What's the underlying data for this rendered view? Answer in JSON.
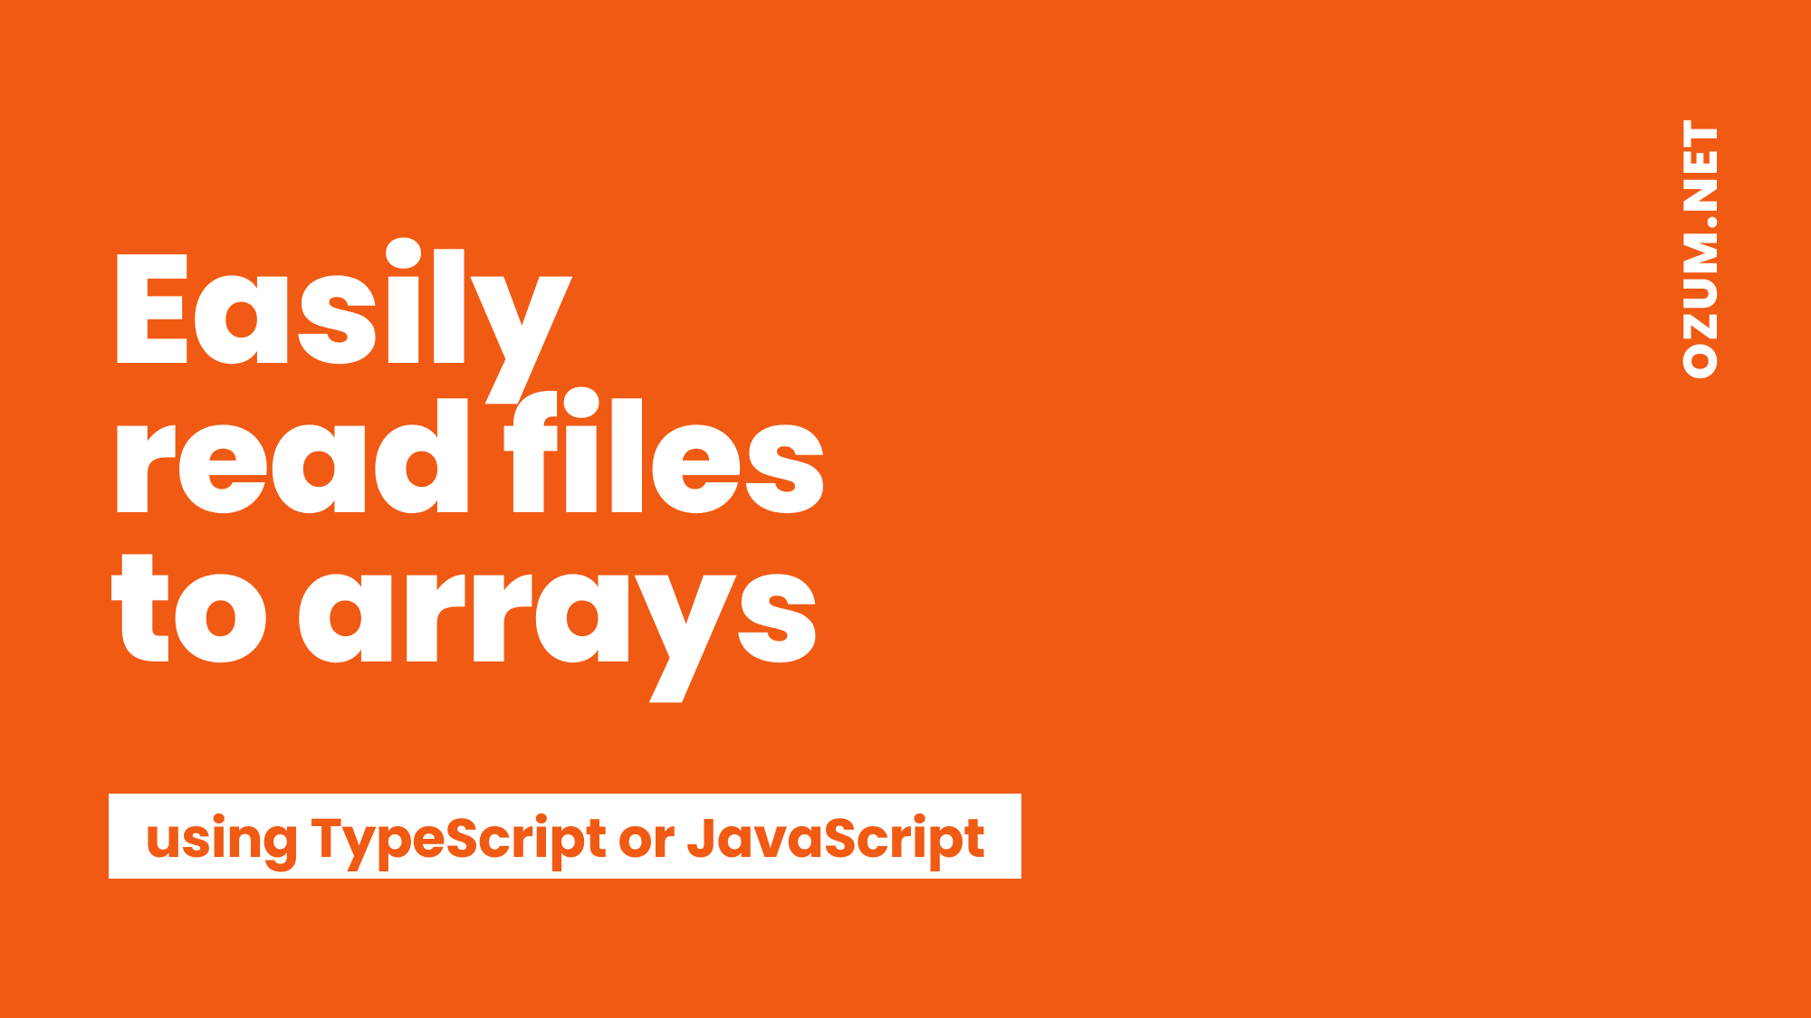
{
  "headline": {
    "line1": "Easily",
    "line2": "read files",
    "line3": "to arrays"
  },
  "subtitle": "using TypeScript or JavaScript",
  "brand": "OZUM.NET",
  "colors": {
    "background": "#F15A13",
    "text_primary": "#FFFFFF"
  }
}
